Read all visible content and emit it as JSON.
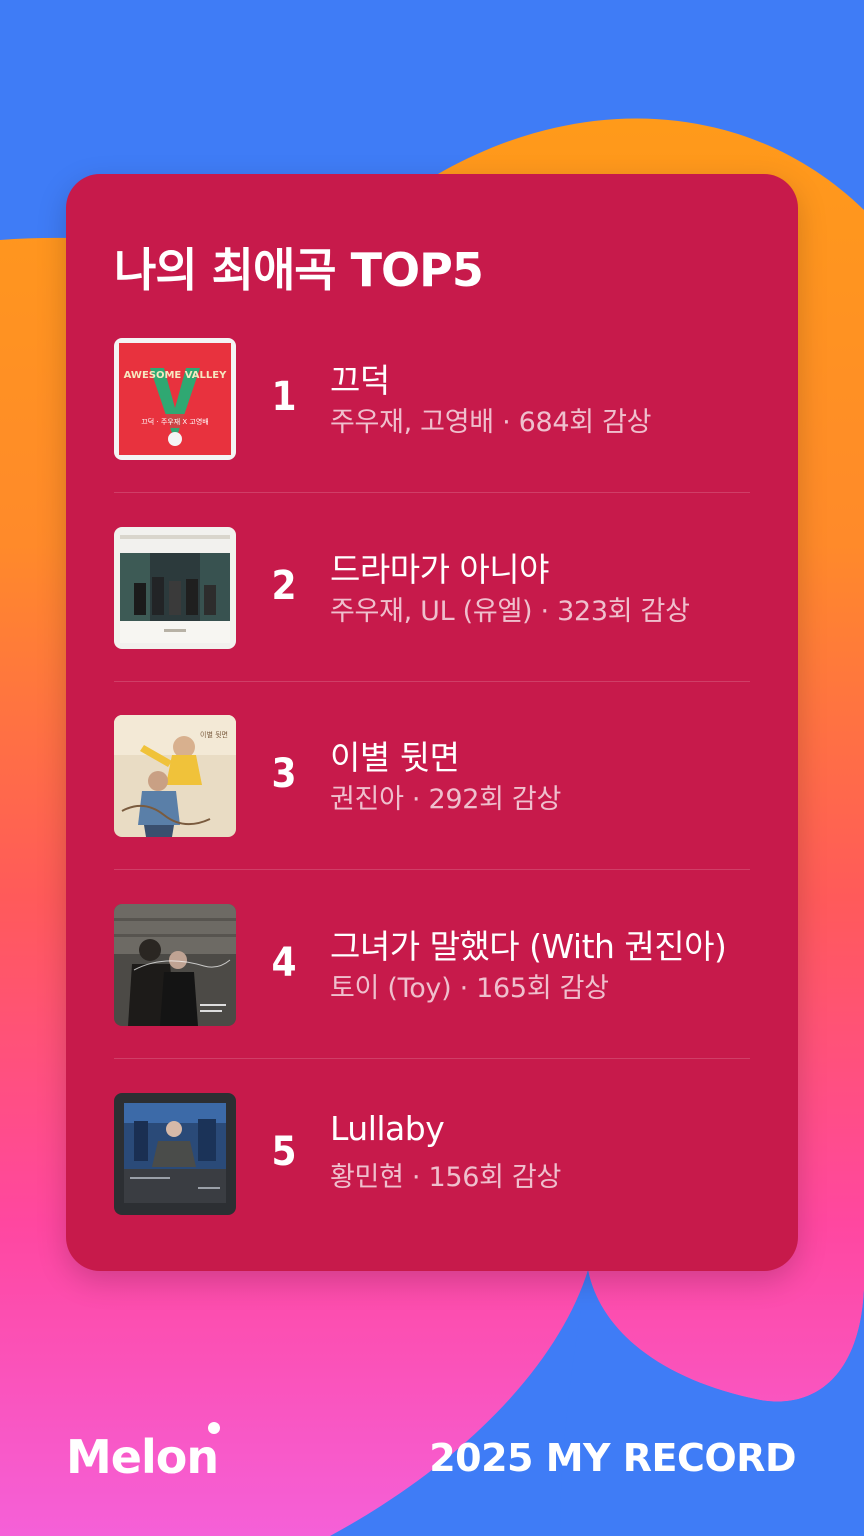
{
  "card": {
    "title": "나의 최애곡 TOP5"
  },
  "tracks": [
    {
      "rank": "1",
      "title": "끄덕",
      "meta": "주우재, 고영배 · 684회 감상"
    },
    {
      "rank": "2",
      "title": "드라마가 아니야",
      "meta": "주우재, UL (유엘) · 323회 감상"
    },
    {
      "rank": "3",
      "title": "이별 뒷면",
      "meta": "권진아 · 292회 감상"
    },
    {
      "rank": "4",
      "title": "그녀가 말했다 (With 권진아)",
      "meta": "토이 (Toy) · 165회 감상"
    },
    {
      "rank": "5",
      "title": "Lullaby",
      "meta": "황민현 · 156회 감상"
    }
  ],
  "album_art_text": {
    "cover1_top": "AWESOME VALLEY",
    "cover1_bottom": "끄덕 · 주우재 X 고영배",
    "cover3_title": "이별 뒷면"
  },
  "footer": {
    "logo": "Melon",
    "label": "2025 MY RECORD"
  },
  "colors": {
    "card": "#c71a4b",
    "background_blue": "#3f7cf6",
    "blob_orange": "#ff9a1a",
    "blob_pink": "#ff4fa7"
  }
}
